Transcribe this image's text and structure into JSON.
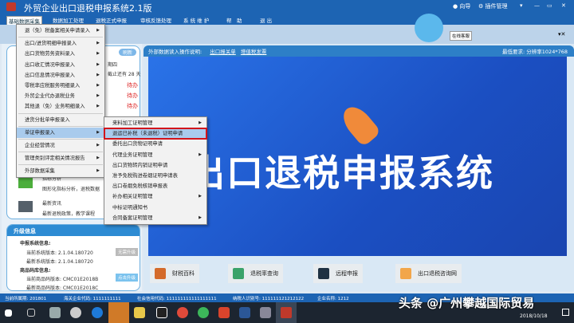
{
  "title": "外贸企业出口退税申报系统2.1版",
  "titlebar_right": {
    "guide": "向导",
    "plugins": "插件管理"
  },
  "menubar": [
    "基础数据采集",
    "数据加工处理",
    "退税正式申报",
    "审核反馈处理",
    "系 统 维 护",
    "帮　助",
    "退 出"
  ],
  "mascot_label": "在线客服",
  "menu_main": [
    {
      "label": "退（免）税备案相关申请录入",
      "arrow": true
    },
    {
      "label": "出口/进货明细申报录入",
      "arrow": true
    },
    {
      "label": "出口货物劳务资料录入",
      "arrow": true
    },
    {
      "label": "出口收汇情况申报录入",
      "arrow": true
    },
    {
      "label": "出口信息情况申报录入",
      "arrow": true
    },
    {
      "label": "零税率应税服务明细录入",
      "arrow": true
    },
    {
      "label": "外贸企业代办退税业务",
      "arrow": true
    },
    {
      "label": "其他退（免）业务明细录入",
      "arrow": true
    },
    {
      "label": "进货分批单申报录入",
      "arrow": false
    },
    {
      "label": "单证申报录入",
      "arrow": true
    },
    {
      "label": "企业经营情况",
      "arrow": true
    },
    {
      "label": "管理类别评定相关情况报告",
      "arrow": true
    },
    {
      "label": "外部数据采集",
      "arrow": true
    }
  ],
  "menu_sub": [
    {
      "label": "来料加工证明管理",
      "arrow": true
    },
    {
      "label": "退运已补税（未退税）证明申请",
      "arrow": false
    },
    {
      "label": "委托出口货物证明申请",
      "arrow": false
    },
    {
      "label": "代理业务证明管理",
      "arrow": true
    },
    {
      "label": "出口货物转内销证明申请",
      "arrow": false
    },
    {
      "label": "准予免税购进卷烟证明申请表",
      "arrow": false
    },
    {
      "label": "出口卷烟免税核销申报表",
      "arrow": false
    },
    {
      "label": "补办相关证明管理",
      "arrow": true
    },
    {
      "label": "中标证明通知书",
      "arrow": false
    },
    {
      "label": "合同备案证明管理",
      "arrow": true
    }
  ],
  "left": {
    "refresh": "刷新",
    "weekday": "期四",
    "deadline": "截止还有 28 天",
    "todo": [
      "待办",
      "待办",
      "待办"
    ],
    "features": [
      {
        "title": "指标分析",
        "desc": "图形化指标分析，退税数据"
      },
      {
        "title": "最新资讯",
        "desc": "最新退税政策，教学课程"
      }
    ],
    "upgrade": {
      "header": "升级信息",
      "sys_title": "申报系统信息:",
      "sys_cur": "当前系统版本: 2.1.04.180720",
      "sys_new": "最新系统版本: 2.1.04.180720",
      "sys_btn": "无需升级",
      "code_title": "商品码库信息:",
      "code_cur": "当前商品码版本: CMC01E2018B",
      "code_new": "最新商品码版本: CMC01E2018C",
      "code_btn": "点击升级"
    }
  },
  "main": {
    "header": "外部数据读入操作说明:",
    "link1": "出口报关单",
    "link2": "增值税发票",
    "requirement": "最低要求: 分辨率1024*768",
    "banner_title": "出口退税申报系统",
    "quick": [
      "财税百科",
      "退税率查询",
      "远程申报",
      "出口退税咨询网"
    ]
  },
  "statusbar": {
    "period": "当前所属期: 201801",
    "customs": "海关企业代码: 1111111111",
    "credit": "社会信用代码: 111111111111111111",
    "taxpayer": "纳税人识别号: 111111121212122",
    "company": "企业名称: 1212"
  },
  "watermark": "头条 @广州攀越国际贸易",
  "date": "2018/10/18",
  "colors": {
    "titlebar": "#1d64b3",
    "highlight": "#d2151b"
  }
}
